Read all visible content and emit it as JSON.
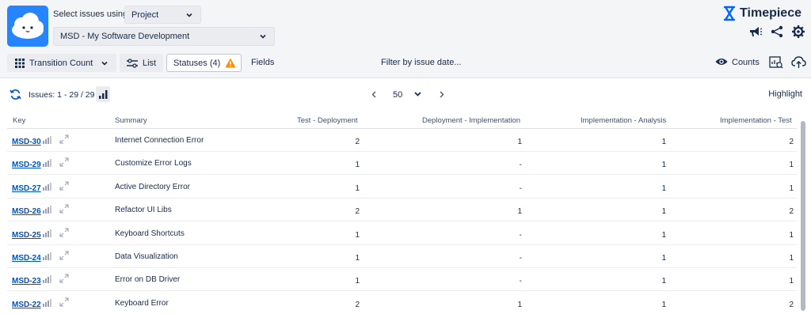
{
  "header": {
    "select_label": "Select issues using",
    "selector_value": "Project",
    "project_value": "MSD - My Software Development",
    "brand": "Timepiece"
  },
  "toolbar": {
    "transition_count": "Transition Count",
    "list": "List",
    "statuses": "Statuses (4)",
    "fields": "Fields",
    "filter": "Filter by issue date...",
    "counts": "Counts"
  },
  "subbar": {
    "issues": "Issues: 1 - 29 / 29",
    "page_size": "50",
    "highlight": "Highlight"
  },
  "columns": [
    "Key",
    "Summary",
    "Test - Deployment",
    "Deployment - Implementation",
    "Implementation - Analysis",
    "Implementation - Test"
  ],
  "rows": [
    {
      "key": "MSD-30",
      "summary": "Internet Connection Error",
      "c1": "2",
      "c2": "1",
      "c3": "1",
      "c4": "2"
    },
    {
      "key": "MSD-29",
      "summary": "Customize Error Logs",
      "c1": "1",
      "c2": "-",
      "c3": "1",
      "c4": "1"
    },
    {
      "key": "MSD-27",
      "summary": "Active Directory Error",
      "c1": "1",
      "c2": "-",
      "c3": "1",
      "c4": "1"
    },
    {
      "key": "MSD-26",
      "summary": "Refactor UI Libs",
      "c1": "2",
      "c2": "1",
      "c3": "1",
      "c4": "2"
    },
    {
      "key": "MSD-25",
      "summary": "Keyboard Shortcuts",
      "c1": "1",
      "c2": "-",
      "c3": "1",
      "c4": "1"
    },
    {
      "key": "MSD-24",
      "summary": "Data Visualization",
      "c1": "1",
      "c2": "-",
      "c3": "1",
      "c4": "1"
    },
    {
      "key": "MSD-23",
      "summary": "Error on DB Driver",
      "c1": "1",
      "c2": "-",
      "c3": "1",
      "c4": "1"
    },
    {
      "key": "MSD-22",
      "summary": "Keyboard Error",
      "c1": "2",
      "c2": "1",
      "c3": "1",
      "c4": "2"
    }
  ],
  "icons": {
    "logo": "cloud-face-logo",
    "brand": "hourglass-icon",
    "announce": "megaphone-icon",
    "share": "share-icon",
    "settings": "gear-icon",
    "grid": "grid-icon",
    "list": "sliders-icon",
    "warning": "warning-icon",
    "eye": "eye-icon",
    "report": "report-icon",
    "cloud": "cloud-upload-icon",
    "refresh": "refresh-icon",
    "chart": "bar-chart-icon"
  },
  "colors": {
    "accent": "#0052cc",
    "logo_bg": "#2684ff",
    "warning": "#ff8b00",
    "brand_icon": "#0065ff"
  }
}
